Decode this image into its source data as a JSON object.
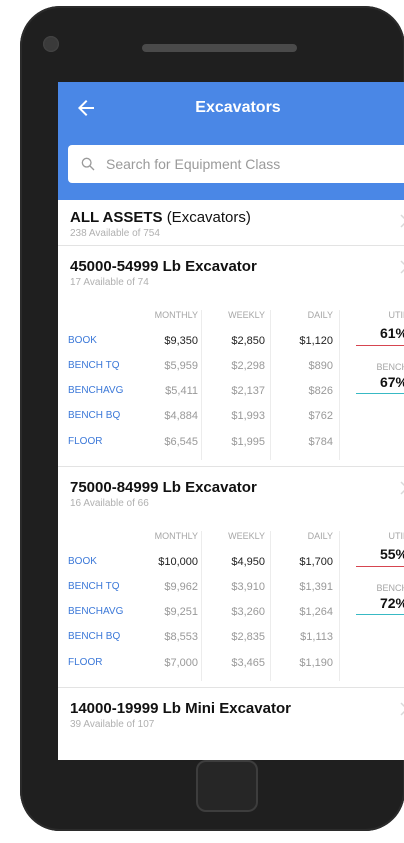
{
  "header": {
    "title": "Excavators"
  },
  "search": {
    "placeholder": "Search for Equipment Class"
  },
  "all_assets": {
    "title": "ALL ASSETS",
    "subtitle": "(Excavators)",
    "available": "238 Available of 754"
  },
  "columns": {
    "monthly": "MONTHLY",
    "weekly": "WEEKLY",
    "daily": "DAILY",
    "util": "UTIL",
    "bench": "BENCH"
  },
  "groups": [
    {
      "name": "45000-54999 Lb Excavator",
      "available": "17 Available of 74",
      "util": "61%",
      "bench": "67%",
      "rows": [
        {
          "label": "BOOK",
          "monthly": "$9,350",
          "weekly": "$2,850",
          "daily": "$1,120"
        },
        {
          "label": "BENCH TQ",
          "monthly": "$5,959",
          "weekly": "$2,298",
          "daily": "$890"
        },
        {
          "label": "BENCHAVG",
          "monthly": "$5,411",
          "weekly": "$2,137",
          "daily": "$826"
        },
        {
          "label": "BENCH BQ",
          "monthly": "$4,884",
          "weekly": "$1,993",
          "daily": "$762"
        },
        {
          "label": "FLOOR",
          "monthly": "$6,545",
          "weekly": "$1,995",
          "daily": "$784"
        }
      ]
    },
    {
      "name": "75000-84999 Lb Excavator",
      "available": "16 Available of 66",
      "util": "55%",
      "bench": "72%",
      "rows": [
        {
          "label": "BOOK",
          "monthly": "$10,000",
          "weekly": "$4,950",
          "daily": "$1,700"
        },
        {
          "label": "BENCH TQ",
          "monthly": "$9,962",
          "weekly": "$3,910",
          "daily": "$1,391"
        },
        {
          "label": "BENCHAVG",
          "monthly": "$9,251",
          "weekly": "$3,260",
          "daily": "$1,264"
        },
        {
          "label": "BENCH BQ",
          "monthly": "$8,553",
          "weekly": "$2,835",
          "daily": "$1,113"
        },
        {
          "label": "FLOOR",
          "monthly": "$7,000",
          "weekly": "$3,465",
          "daily": "$1,190"
        }
      ]
    }
  ],
  "last_group": {
    "name": "14000-19999 Lb Mini Excavator",
    "available": "39 Available of 107"
  },
  "colors": {
    "appbar": "#4a87e6",
    "label_blue": "#3b78d8",
    "util_line": "#d64550",
    "bench_line": "#38b9c4"
  }
}
